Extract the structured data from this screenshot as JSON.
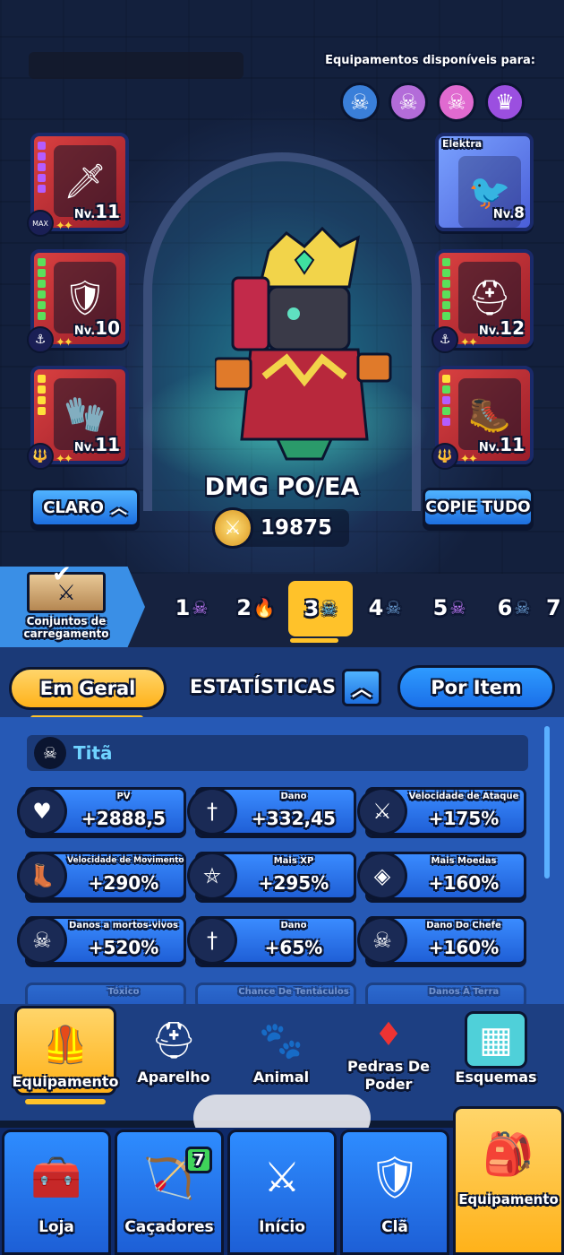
{
  "hero": {
    "available_title": "Equipamentos disponíveis para:",
    "available_icons": [
      "skull-hooded-icon",
      "brain-skull-icon",
      "pink-skull-icon",
      "crowned-skull-icon"
    ],
    "left_slots": [
      {
        "level_prefix": "Nv.",
        "level": "11",
        "badge": "MAX",
        "rarity": "purple"
      },
      {
        "level_prefix": "Nv.",
        "level": "10",
        "rarity": "green"
      },
      {
        "level_prefix": "Nv.",
        "level": "11",
        "rarity": "yellow"
      }
    ],
    "right_slots": [
      {
        "name": "Elektra",
        "level_prefix": "Nv.",
        "level": "8"
      },
      {
        "level_prefix": "Nv.",
        "level": "12",
        "rarity": "green"
      },
      {
        "level_prefix": "Nv.",
        "level": "11",
        "rarity": "multi"
      }
    ],
    "clear_button": "CLARO",
    "copy_button": "COPIE TUDO",
    "damage_label": "DMG PO/EA",
    "power_value": "19875"
  },
  "loadout": {
    "label": "Conjuntos de carregamento",
    "tabs": [
      {
        "num": "1",
        "icon": "brain-skull-icon"
      },
      {
        "num": "2",
        "icon": "fire-icon"
      },
      {
        "num": "3",
        "icon": "skull-icon",
        "active": true
      },
      {
        "num": "4",
        "icon": "skull-icon"
      },
      {
        "num": "5",
        "icon": "brain-skull-icon"
      },
      {
        "num": "6",
        "icon": "skull-icon"
      },
      {
        "num": "7",
        "icon": ""
      }
    ]
  },
  "panel": {
    "tab_overall": "Em Geral",
    "stats_title": "ESTATÍSTICAS",
    "tab_item": "Por Item",
    "section_title": "Titã",
    "stats": [
      {
        "label": "PV",
        "value": "+2888,5",
        "icon": "heart-icon"
      },
      {
        "label": "Dano",
        "value": "+332,45",
        "icon": "dagger-icon"
      },
      {
        "label": "Velocidade de Ataque",
        "value": "+175%",
        "icon": "sword-speed-icon"
      },
      {
        "label": "Velocidade de Movimento",
        "value": "+290%",
        "icon": "winged-boot-icon"
      },
      {
        "label": "Mais XP",
        "value": "+295%",
        "icon": "pentagram-icon"
      },
      {
        "label": "Mais Moedas",
        "value": "+160%",
        "icon": "coin-icon"
      },
      {
        "label": "Danos a mortos-vivos",
        "value": "+520%",
        "icon": "skull-icon"
      },
      {
        "label": "Dano",
        "value": "+65%",
        "icon": "dagger-icon"
      },
      {
        "label": "Dano Do Chefe",
        "value": "+160%",
        "icon": "horned-skull-icon"
      }
    ],
    "faded_stats": [
      "Tóxico",
      "Chance De Tentáculos",
      "Danos À Terra"
    ]
  },
  "gear_categories": [
    {
      "label": "Equipamento",
      "icon": "armor-icon",
      "active": true
    },
    {
      "label": "Aparelho",
      "icon": "helmet-icon"
    },
    {
      "label": "Animal",
      "icon": "paw-icon"
    },
    {
      "label": "Pedras De Poder",
      "icon": "gem-icon"
    },
    {
      "label": "Esquemas",
      "icon": "blueprint-icon"
    }
  ],
  "nav": [
    {
      "label": "Loja",
      "icon": "chest-icon"
    },
    {
      "label": "Caçadores",
      "icon": "crossbow-icon",
      "badge": "7"
    },
    {
      "label": "Início",
      "icon": "crossed-swords-icon"
    },
    {
      "label": "Clã",
      "icon": "clan-shield-icon"
    },
    {
      "label": "Equipamento",
      "icon": "gear-bag-icon",
      "active": true
    }
  ],
  "colors": {
    "accent_yellow": "#ffc22a",
    "primary_blue": "#2e8cff",
    "panel_blue": "#2659b5",
    "outline": "#0b1530"
  }
}
